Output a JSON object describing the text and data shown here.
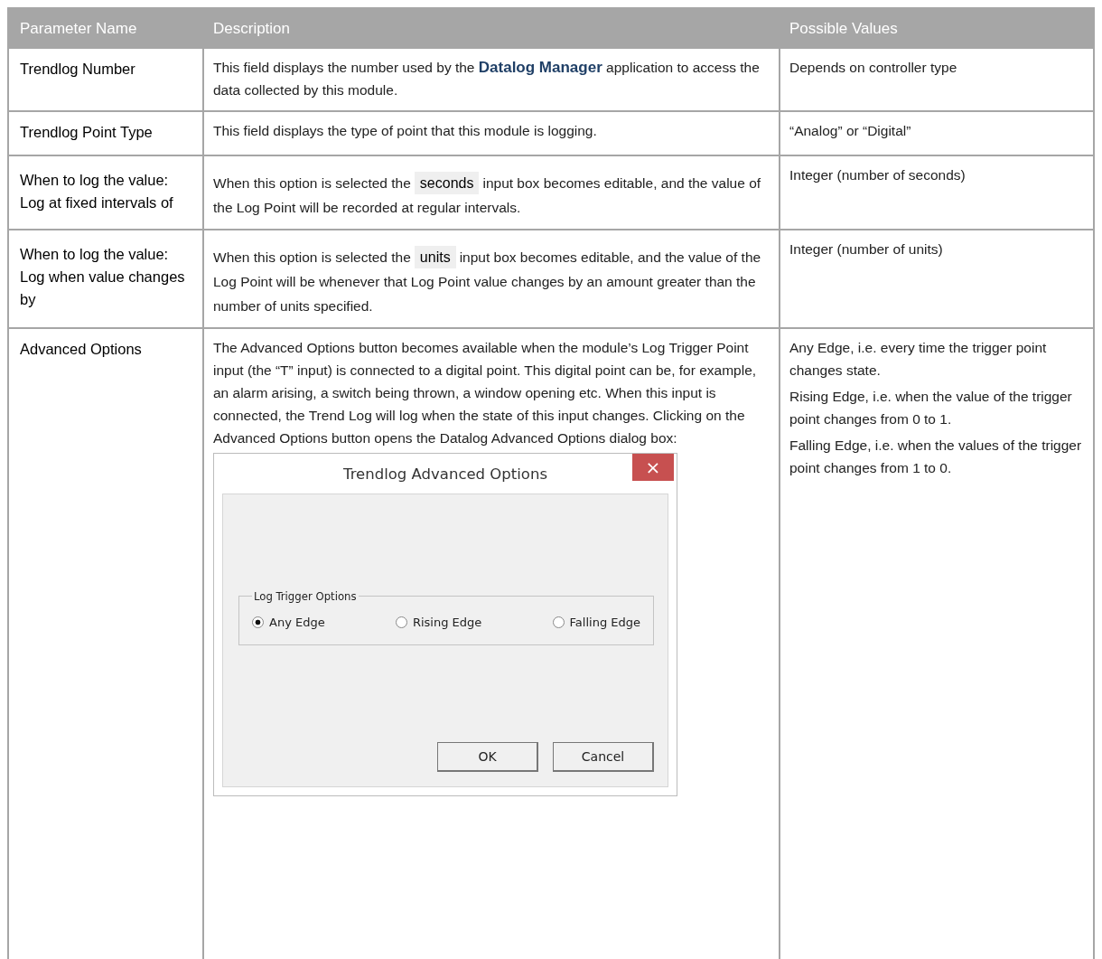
{
  "table": {
    "columns": [
      "Parameter Name",
      "Description",
      "Possible Values"
    ],
    "rows": [
      {
        "name": "Trendlog Number",
        "description": {
          "kind": "text",
          "text": "This field displays the number used by the **Datalog Manager** application to access the data collected by this module."
        },
        "values": [
          "Depends on controller type"
        ]
      },
      {
        "name": "Trendlog Point Type",
        "description": {
          "kind": "text",
          "text": "This field displays the type of point that this module is logging."
        },
        "values": [
          "“Analog” or “Digital”"
        ]
      },
      {
        "name": "When to log the value: Log at fixed intervals of",
        "description": {
          "kind": "field",
          "before": "When this option is selected the",
          "field": "seconds",
          "after": "input  box becomes editable, and  the value of the Log Point will be recorded at regular intervals."
        },
        "values": [
          "Integer (number of seconds)"
        ]
      },
      {
        "name": "When to log the value: Log when value changes by",
        "description": {
          "kind": "field",
          "before": "When this option is selected the",
          "field": "units",
          "after": "input  box becomes editable, and  the value of the Log Point will be whenever that Log Point value changes by an amount greater than the number of units specified."
        },
        "values": [
          "Integer (number of units)"
        ]
      },
      {
        "name": "Advanced Options",
        "description": {
          "kind": "dialog",
          "text": "The Advanced Options button becomes available when the module’s Log Trigger Point input (the “T” input) is connected to a digital point. This digital point can be, for example, an alarm arising, a switch being thrown, a window opening etc. When this input is connected, the Trend Log will log when the state of this input changes. Clicking on the Advanced Options button opens the Datalog Advanced Options dialog box:",
          "dialog": {
            "title": "Trendlog Advanced Options",
            "close": "×",
            "group": "Log Trigger Options",
            "options": [
              {
                "label": "Any Edge",
                "selected": true
              },
              {
                "label": "Rising Edge",
                "selected": false
              },
              {
                "label": "Falling Edge",
                "selected": false
              }
            ],
            "buttons": [
              "OK",
              "Cancel"
            ]
          }
        },
        "values": [
          "Any Edge, i.e.  every time the trigger point changes state.",
          "Rising Edge, i.e. when the value of the trigger point changes from 0 to 1.",
          "Falling Edge, i.e. when the values of the trigger point changes from 1 to 0."
        ]
      }
    ]
  }
}
